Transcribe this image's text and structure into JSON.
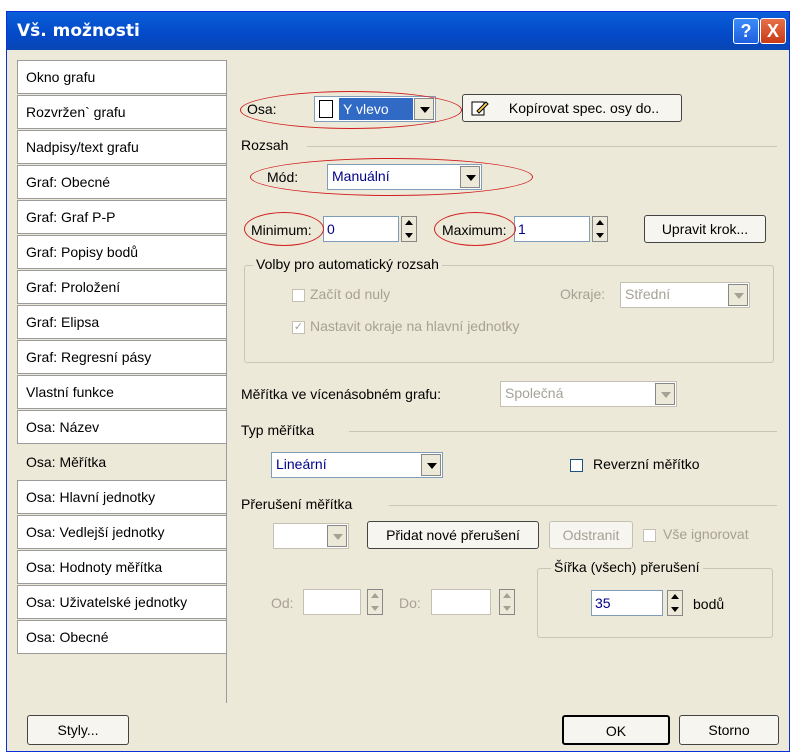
{
  "window": {
    "title": "Vš. možnosti",
    "help_label": "?",
    "close_label": "X"
  },
  "sidebar": {
    "items": [
      {
        "label": "Okno grafu"
      },
      {
        "label": "Rozvržen` grafu"
      },
      {
        "label": "Nadpisy/text grafu"
      },
      {
        "label": "Graf: Obecné"
      },
      {
        "label": "Graf: Graf P-P"
      },
      {
        "label": "Graf: Popisy bodů"
      },
      {
        "label": "Graf: Proložení"
      },
      {
        "label": "Graf: Elipsa"
      },
      {
        "label": "Graf: Regresní pásy"
      },
      {
        "label": "Vlastní funkce"
      },
      {
        "label": "Osa: Název"
      },
      {
        "label": "Osa: Měřítka"
      },
      {
        "label": "Osa: Hlavní jednotky"
      },
      {
        "label": "Osa: Vedlejší jednotky"
      },
      {
        "label": "Osa: Hodnoty měřítka"
      },
      {
        "label": "Osa: Uživatelské jednotky"
      },
      {
        "label": "Osa: Obecné"
      }
    ],
    "active_index": 11
  },
  "axis": {
    "label": "Osa:",
    "value": "Y vlevo",
    "copy_button": "Kopírovat spec. osy do.."
  },
  "range": {
    "section": "Rozsah",
    "mode_label": "Mód:",
    "mode_value": "Manuální",
    "min_label": "Minimum:",
    "min_value": "0",
    "max_label": "Maximum:",
    "max_value": "1",
    "step_button": "Upravit krok...",
    "auto_group": "Volby pro automatický rozsah",
    "start_zero": "Začít od nuly",
    "margins_label": "Okraje:",
    "margins_value": "Střední",
    "set_margins": "Nastavit okraje na hlavní jednotky",
    "set_margins_mark": "✓"
  },
  "multi": {
    "label": "Měřítka ve vícenásobném grafu:",
    "value": "Společná"
  },
  "scale_type": {
    "section": "Typ měřítka",
    "value": "Lineární",
    "reverse_label": "Reverzní měřítko"
  },
  "breaks": {
    "section": "Přerušení měřítka",
    "add_button": "Přidat nové přerušení",
    "remove_button": "Odstranit",
    "ignore_label": "Vše ignorovat",
    "from_label": "Od:",
    "to_label": "Do:",
    "width_group": "Šířka (všech) přerušení",
    "width_value": "35",
    "width_unit": "bodů"
  },
  "footer": {
    "styles_button": "Styly...",
    "ok_button": "OK",
    "cancel_button": "Storno"
  },
  "colors": {
    "annotation": "#d21e1e",
    "titlebar": "#0349c8",
    "selection": "#316ac5"
  }
}
